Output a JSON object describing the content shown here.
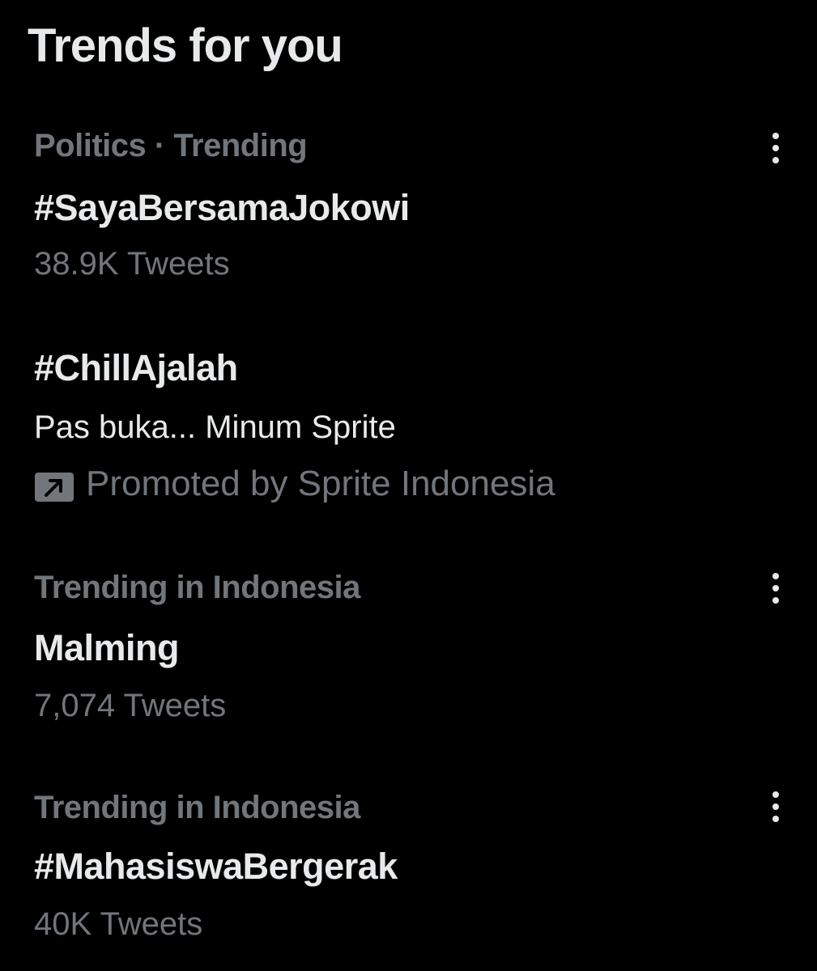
{
  "panel": {
    "title": "Trends for you"
  },
  "trends": [
    {
      "context": "Politics · Trending",
      "name": "#SayaBersamaJokowi",
      "count": "38.9K Tweets"
    },
    {
      "name": "#ChillAjalah",
      "description": "Pas buka... Minum Sprite",
      "promoted": "Promoted by Sprite Indonesia"
    },
    {
      "context": "Trending in Indonesia",
      "name": "Malming",
      "count": "7,074 Tweets"
    },
    {
      "context": "Trending in Indonesia",
      "name": "#MahasiswaBergerak",
      "count": "40K Tweets"
    }
  ],
  "icons": {
    "more": "more-icon",
    "promoted": "promoted-arrow-icon"
  },
  "colors": {
    "background": "#000000",
    "primary_text": "#e7e9ea",
    "secondary_text": "#71767b"
  }
}
